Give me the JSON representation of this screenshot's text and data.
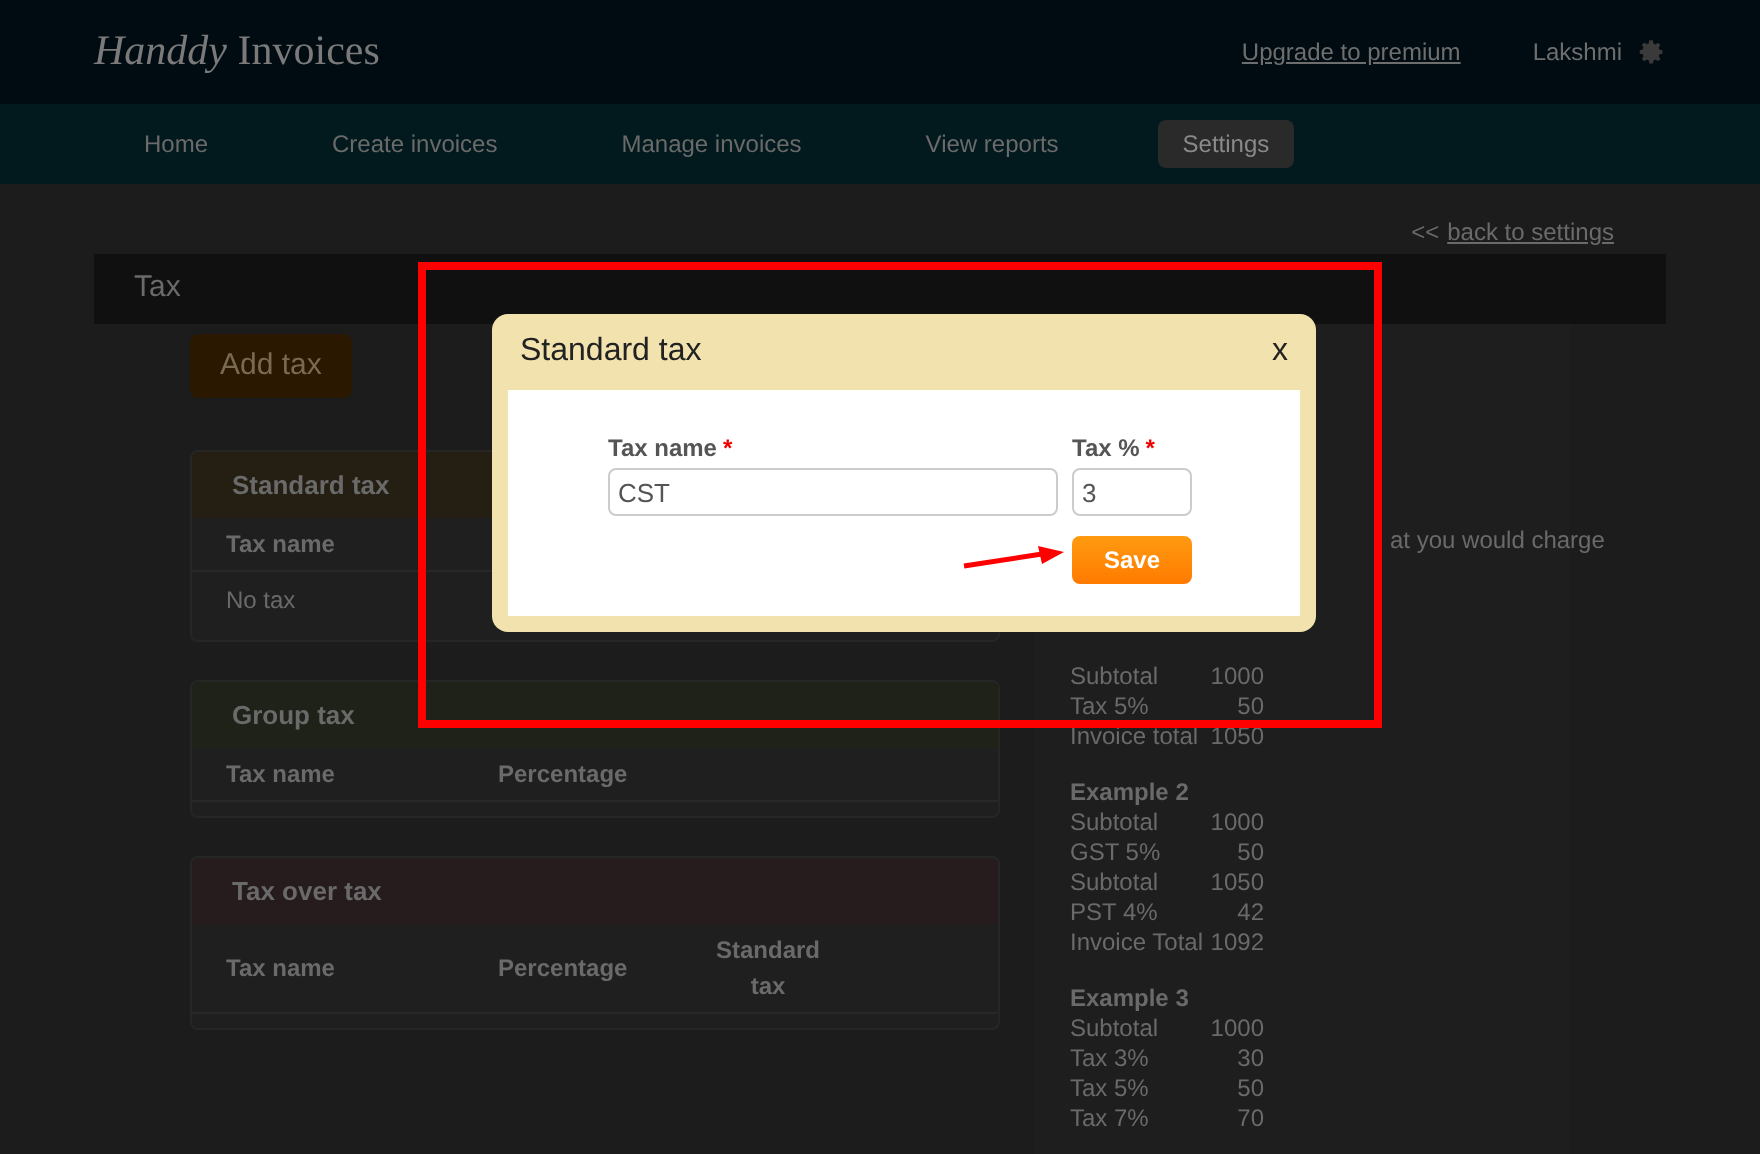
{
  "header": {
    "logo_script": "Handdy",
    "logo_text": "Invoices",
    "upgrade_link": "Upgrade to premium",
    "user_name": "Lakshmi"
  },
  "nav": [
    {
      "label": "Home",
      "selected": false
    },
    {
      "label": "Create invoices",
      "selected": false
    },
    {
      "label": "Manage invoices",
      "selected": false
    },
    {
      "label": "View reports",
      "selected": false
    },
    {
      "label": "Settings",
      "selected": true
    }
  ],
  "back_link": {
    "arrows": "<<",
    "label": "back to settings"
  },
  "section_title": "Tax",
  "add_button": "Add tax",
  "tables": [
    {
      "title": "Standard tax",
      "color": "#241f12",
      "columns": [
        "Tax name"
      ],
      "rows": [
        [
          "No tax"
        ]
      ]
    },
    {
      "title": "Group tax",
      "color": "#1f2219",
      "columns": [
        "Tax name",
        "Percentage"
      ]
    },
    {
      "title": "Tax over tax",
      "color": "#261b1d",
      "columns": [
        "Tax name",
        "Percentage",
        "Standard tax"
      ]
    }
  ],
  "description": "at you would charge",
  "examples": [
    {
      "rows": [
        [
          "Subtotal",
          "1000"
        ],
        [
          "Tax 5%",
          "50"
        ],
        [
          "Invoice total",
          "1050"
        ]
      ]
    },
    {
      "title": "Example 2",
      "rows": [
        [
          "Subtotal",
          "1000"
        ],
        [
          "GST 5%",
          "50"
        ],
        [
          "Subtotal",
          "1050"
        ],
        [
          "PST 4%",
          "42"
        ],
        [
          "Invoice Total",
          "1092"
        ]
      ]
    },
    {
      "title": "Example 3",
      "rows": [
        [
          "Subtotal",
          "1000"
        ],
        [
          "Tax 3%",
          "30"
        ],
        [
          "Tax 5%",
          "50"
        ],
        [
          "Tax 7%",
          "70"
        ]
      ]
    }
  ],
  "modal": {
    "title": "Standard tax",
    "close": "x",
    "fields": [
      {
        "label": "Tax name",
        "mark": "*",
        "value": "CST",
        "kind": "wide"
      },
      {
        "label": "Tax %",
        "mark": "*",
        "value": "3",
        "kind": "narrow"
      }
    ],
    "save_button": "Save"
  }
}
